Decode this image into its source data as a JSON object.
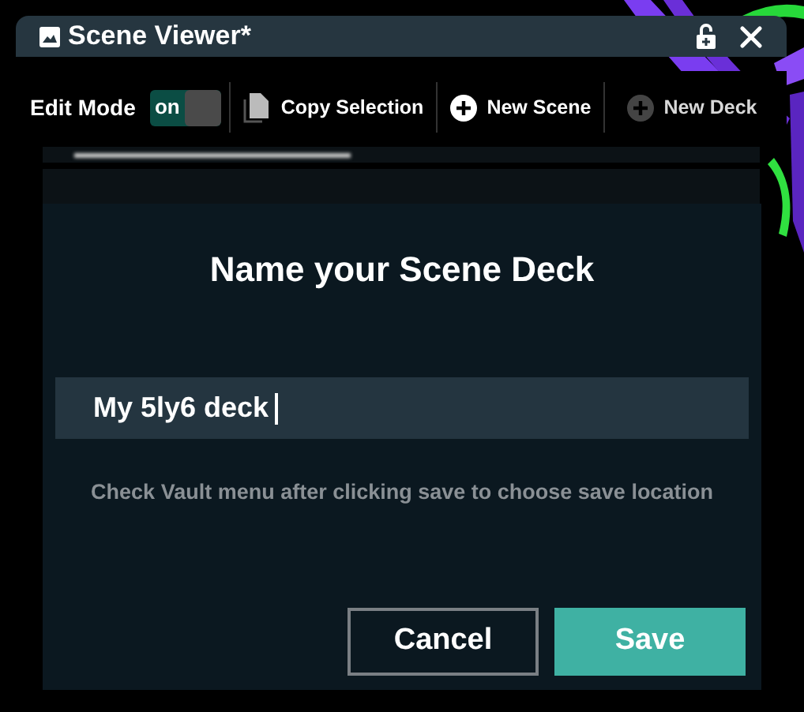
{
  "window": {
    "title": "Scene Viewer*",
    "locked": false
  },
  "toolbar": {
    "edit_mode": {
      "label": "Edit Mode",
      "on": true,
      "state_text": "on"
    },
    "buttons": [
      {
        "label": "Copy Selection",
        "kind": "copy",
        "disabled": false
      },
      {
        "label": "New Scene",
        "kind": "add",
        "disabled": false
      },
      {
        "label": "New Deck",
        "kind": "add",
        "disabled": true
      }
    ]
  },
  "dialog": {
    "title": "Name your Scene Deck",
    "input": {
      "value": "My 5ly6 deck"
    },
    "hint": "Check Vault menu after clicking save to choose save location",
    "cancel": "Cancel",
    "save": "Save"
  }
}
